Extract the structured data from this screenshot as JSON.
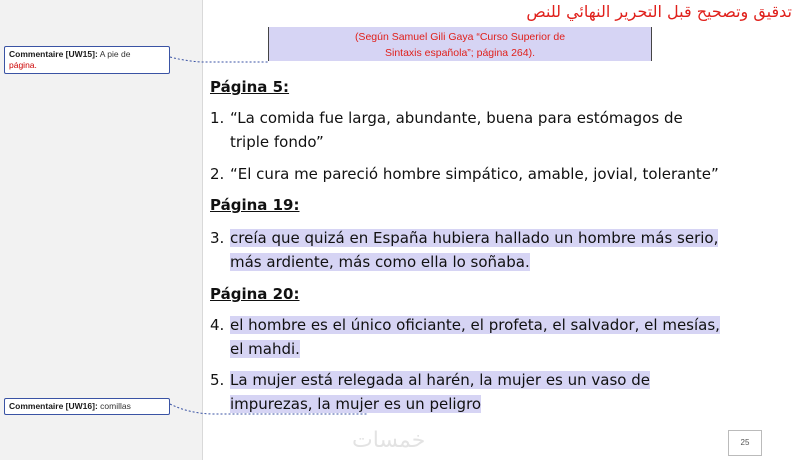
{
  "title": "تدقيق وتصحيح قبل التحرير النهائي للنص",
  "comments": [
    {
      "label": "Commentaire [UW15]:",
      "text_a": "A pie de",
      "text_b": "página."
    },
    {
      "label": "Commentaire [UW16]:",
      "text": "comillas"
    }
  ],
  "citation": {
    "line1": "(Según Samuel Gili Gaya “Curso Superior de",
    "line2": "Sintaxis española”; página 264)."
  },
  "sections": [
    {
      "heading": "Página 5:"
    },
    {
      "heading": "Página 19:"
    },
    {
      "heading": "Página 20:"
    }
  ],
  "items": [
    {
      "num": "1.",
      "text": "“La comida fue larga, abundante, buena para estómagos de triple fondo”"
    },
    {
      "num": "2.",
      "text": " “El cura me pareció hombre simpático, amable, jovial, tolerante”"
    },
    {
      "num": "3.",
      "text": "creía que quizá en España hubiera hallado un hombre más serio, más ardiente, más como ella lo soñaba."
    },
    {
      "num": "4.",
      "text": "el hombre es el único oficiante, el profeta, el salvador, el mesías, el mahdi."
    },
    {
      "num": "5.",
      "text": "La mujer está relegada al harén, la mujer es un vaso de impurezas, la mujer es un peligro"
    }
  ],
  "page_number": "25",
  "watermark": "خمسات"
}
